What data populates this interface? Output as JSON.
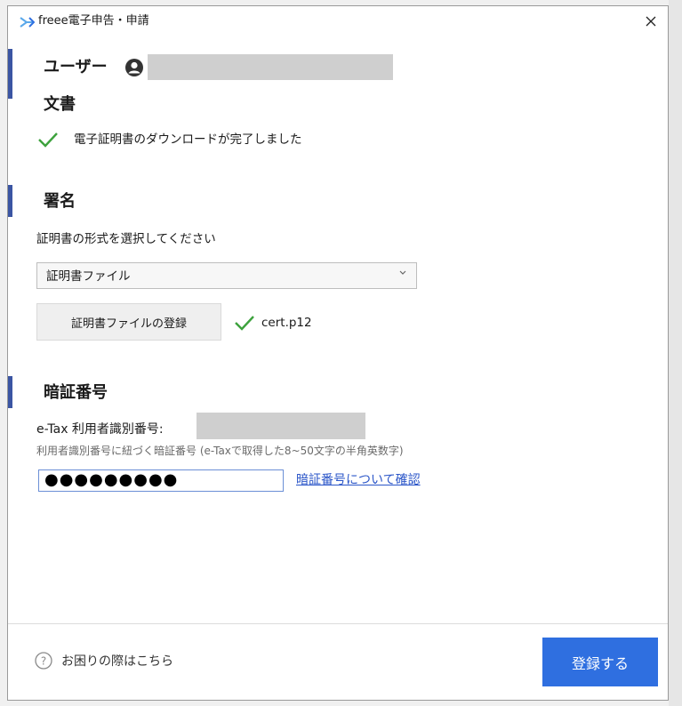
{
  "window": {
    "title": "freee電子申告・申請"
  },
  "user": {
    "label": "ユーザー"
  },
  "document": {
    "heading": "文書",
    "status": "電子証明書のダウンロードが完了しました"
  },
  "signature": {
    "heading": "署名",
    "prompt": "証明書の形式を選択してください",
    "selected_format": "証明書ファイル",
    "register_button": "証明書ファイルの登録",
    "filename": "cert.p12"
  },
  "pin": {
    "heading": "暗証番号",
    "etax_id_label": "e-Tax 利用者識別番号:",
    "hint": "利用者識別番号に紐づく暗証番号 (e-Taxで取得した8~50文字の半角英数字)",
    "masked_value": "●●●●●●●●●",
    "link": "暗証番号について確認"
  },
  "footer": {
    "help": "お困りの際はこちら",
    "submit": "登録する"
  },
  "colors": {
    "accent": "#3b55a3",
    "primary": "#2f6fe0",
    "check": "#3da23d",
    "link": "#2a55c8"
  },
  "icons": [
    "freee-logo-icon",
    "close-icon",
    "user-icon",
    "check-icon",
    "chevron-down-icon",
    "help-icon"
  ]
}
